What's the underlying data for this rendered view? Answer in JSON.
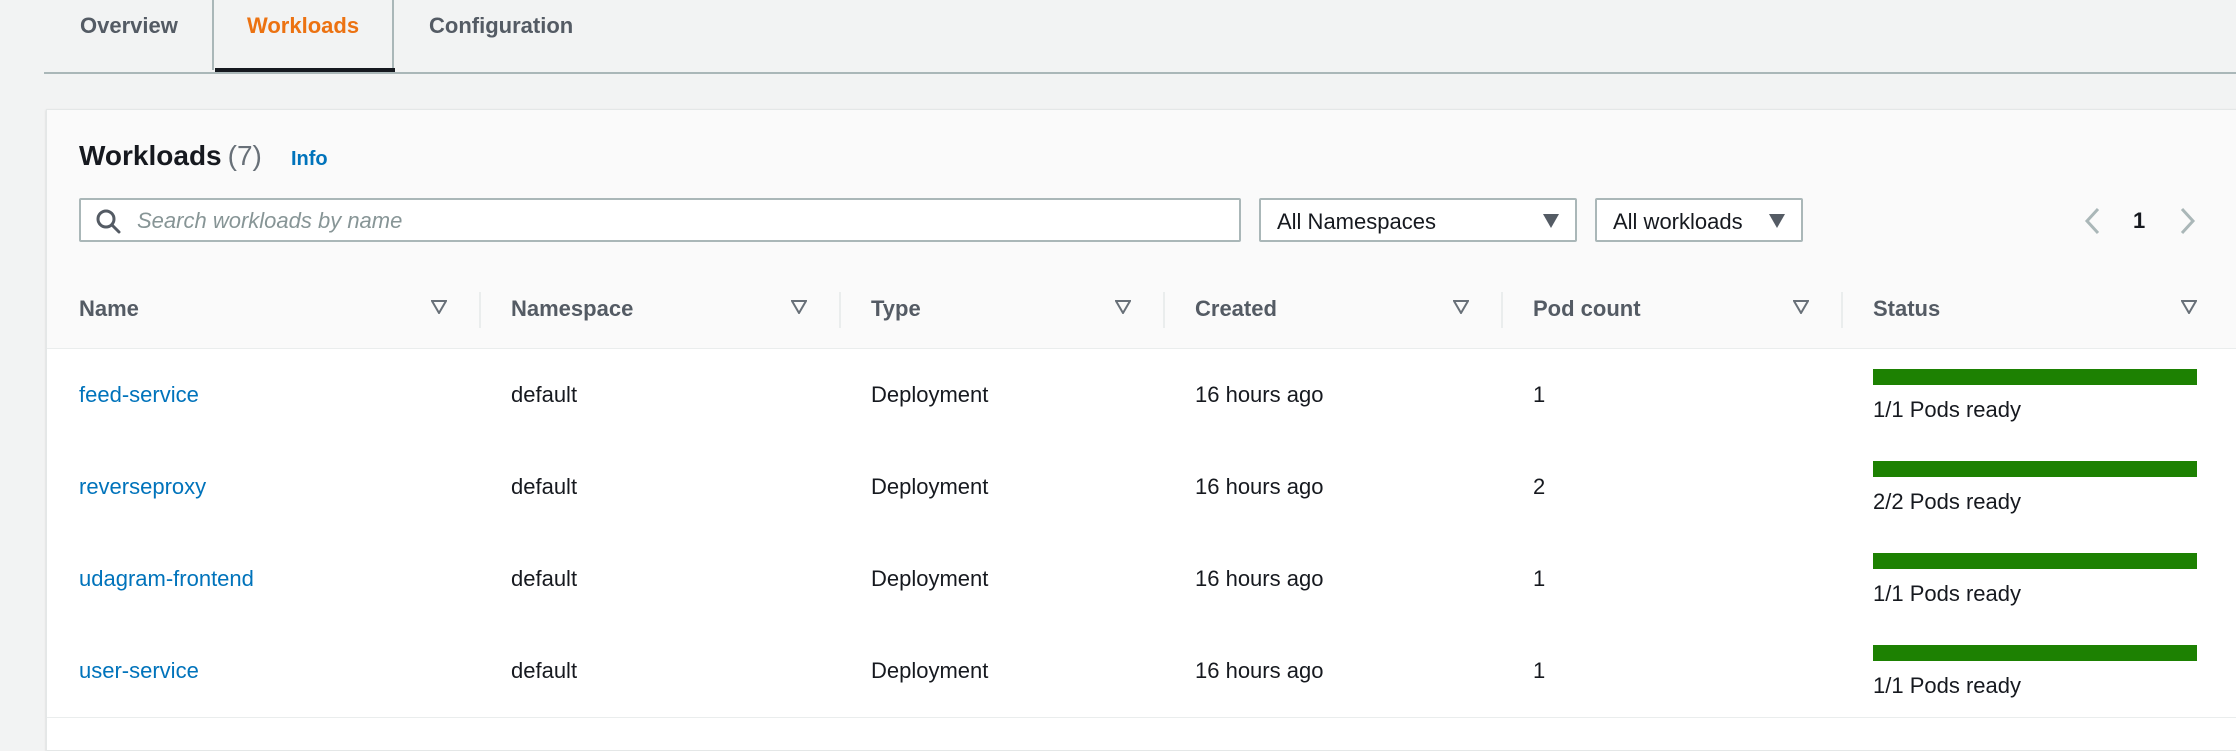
{
  "tabs": [
    {
      "label": "Overview",
      "active": false
    },
    {
      "label": "Workloads",
      "active": true
    },
    {
      "label": "Configuration",
      "active": false
    }
  ],
  "panel": {
    "title": "Workloads",
    "count": "(7)",
    "info_label": "Info"
  },
  "search": {
    "placeholder": "Search workloads by name",
    "value": ""
  },
  "filters": {
    "namespace": "All Namespaces",
    "workloads": "All workloads"
  },
  "pagination": {
    "current_page": "1"
  },
  "table": {
    "columns": [
      "Name",
      "Namespace",
      "Type",
      "Created",
      "Pod count",
      "Status"
    ],
    "rows": [
      {
        "name": "feed-service",
        "namespace": "default",
        "type": "Deployment",
        "created": "16 hours ago",
        "pod_count": "1",
        "status": "1/1 Pods ready",
        "ready_fraction": 1.0
      },
      {
        "name": "reverseproxy",
        "namespace": "default",
        "type": "Deployment",
        "created": "16 hours ago",
        "pod_count": "2",
        "status": "2/2 Pods ready",
        "ready_fraction": 1.0
      },
      {
        "name": "udagram-frontend",
        "namespace": "default",
        "type": "Deployment",
        "created": "16 hours ago",
        "pod_count": "1",
        "status": "1/1 Pods ready",
        "ready_fraction": 1.0
      },
      {
        "name": "user-service",
        "namespace": "default",
        "type": "Deployment",
        "created": "16 hours ago",
        "pod_count": "1",
        "status": "1/1 Pods ready",
        "ready_fraction": 1.0
      }
    ]
  },
  "colors": {
    "accent_tab": "#ec7211",
    "link": "#0073bb",
    "status_ready": "#1d8102"
  },
  "icons": {
    "search": "search-icon",
    "caret": "caret-down-icon",
    "sort": "sort-icon",
    "prev": "chevron-left-icon",
    "next": "chevron-right-icon"
  }
}
